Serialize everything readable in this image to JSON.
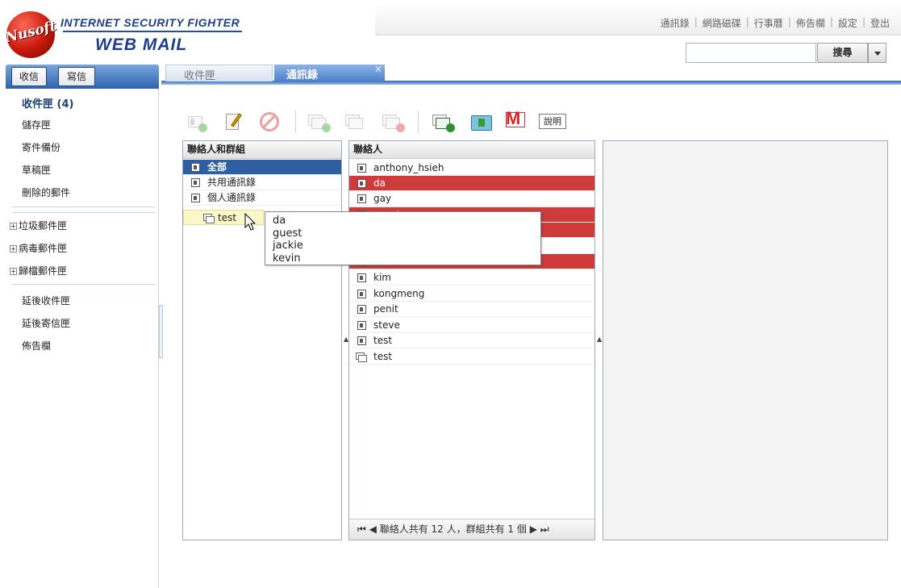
{
  "brand": {
    "script": "Nusoft",
    "line1": "INTERNET SECURITY FIGHTER",
    "line2": "WEB MAIL"
  },
  "top_links": [
    "通訊錄",
    "網路磁碟",
    "行事曆",
    "佈告欄",
    "設定",
    "登出"
  ],
  "search": {
    "value": "",
    "button": "搜尋"
  },
  "nav": {
    "inbox_btn": "收信",
    "compose_btn": "寫信",
    "folders": [
      "收件匣 (4)",
      "儲存匣",
      "寄件備份",
      "草稿匣",
      "刪除的郵件"
    ],
    "tree_folders": [
      "垃圾郵件匣",
      "病毒郵件匣",
      "歸檔郵件匣"
    ],
    "extra": [
      "延後收件匣",
      "延後寄信匣",
      "佈告欄"
    ]
  },
  "tabs": [
    {
      "label": "收件匣"
    },
    {
      "label": "通訊錄"
    }
  ],
  "toolbar": {
    "help": "說明"
  },
  "groups_panel": {
    "header": "聯絡人和群組",
    "items": [
      "全部",
      "共用通訊錄",
      "個人通訊錄",
      "test"
    ]
  },
  "contacts_panel": {
    "header": "聯絡人",
    "items": [
      "anthony_hsieh",
      "da",
      "gay",
      "guest",
      "jackie",
      "kevin",
      "",
      "kim",
      "kongmeng",
      "penit",
      "steve",
      "test",
      "test"
    ],
    "footer": "聯絡人共有 12 人，群組共有 1 個"
  },
  "drag_tooltip": [
    "da",
    "guest",
    "jackie",
    "kevin"
  ],
  "colors": {
    "accent_blue": "#2e5fa0",
    "selection_red": "#cf3a3a"
  }
}
